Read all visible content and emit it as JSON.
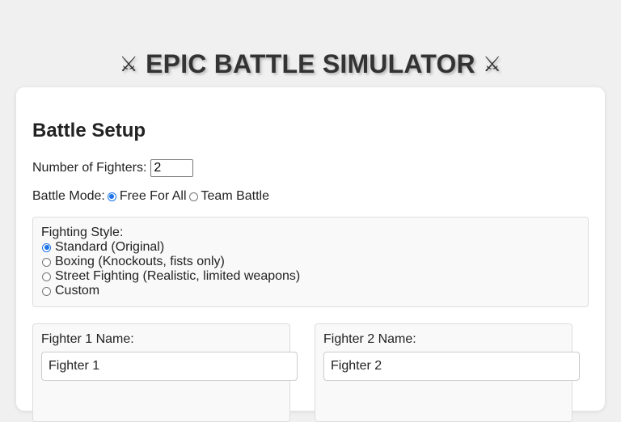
{
  "header": {
    "title": "EPIC BATTLE SIMULATOR",
    "left_icon": "crossed-swords-icon",
    "right_icon": "crossed-swords-icon"
  },
  "setup": {
    "title": "Battle Setup",
    "fighter_count_label": "Number of Fighters:",
    "fighter_count_value": "2",
    "battle_mode_label": "Battle Mode:",
    "battle_modes": [
      {
        "label": "Free For All",
        "selected": true
      },
      {
        "label": "Team Battle",
        "selected": false
      }
    ],
    "fighting_style_label": "Fighting Style:",
    "fighting_styles": [
      {
        "label": "Standard (Original)",
        "selected": true
      },
      {
        "label": "Boxing (Knockouts, fists only)",
        "selected": false
      },
      {
        "label": "Street Fighting (Realistic, limited weapons)",
        "selected": false
      },
      {
        "label": "Custom",
        "selected": false
      }
    ]
  },
  "fighters": [
    {
      "label": "Fighter 1 Name:",
      "value": "Fighter 1"
    },
    {
      "label": "Fighter 2 Name:",
      "value": "Fighter 2"
    }
  ],
  "colors": {
    "accent": "#1a73e8",
    "page_background": "#f0f0f0",
    "card_background": "#ffffff",
    "panel_background": "#f9f9f9"
  }
}
